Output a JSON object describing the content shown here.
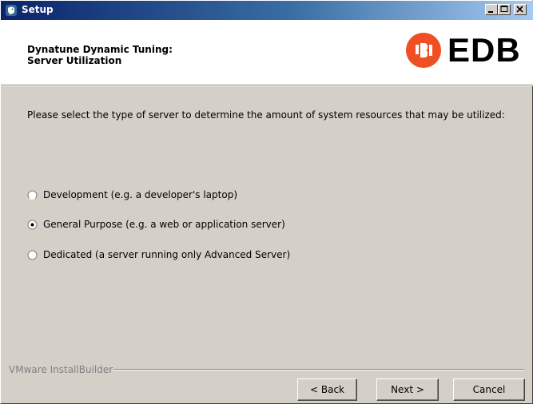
{
  "window": {
    "title": "Setup",
    "minimize_icon": "minimize-icon",
    "maximize_icon": "maximize-icon",
    "close_icon": "close-icon"
  },
  "header": {
    "title_line1": "Dynatune Dynamic Tuning:",
    "title_line2": "Server Utilization",
    "logo_text": "EDB",
    "logo_color": "#f04e23"
  },
  "prompt": "Please select the type of server to determine the amount of system resources that may be utilized:",
  "options": [
    {
      "label": "Development (e.g. a developer's laptop)",
      "selected": false
    },
    {
      "label": "General Purpose (e.g. a web or application server)",
      "selected": true
    },
    {
      "label": "Dedicated (a server running only Advanced Server)",
      "selected": false
    }
  ],
  "footer": {
    "brand": "VMware InstallBuilder",
    "back_label": "< Back",
    "next_label": "Next >",
    "cancel_label": "Cancel"
  }
}
